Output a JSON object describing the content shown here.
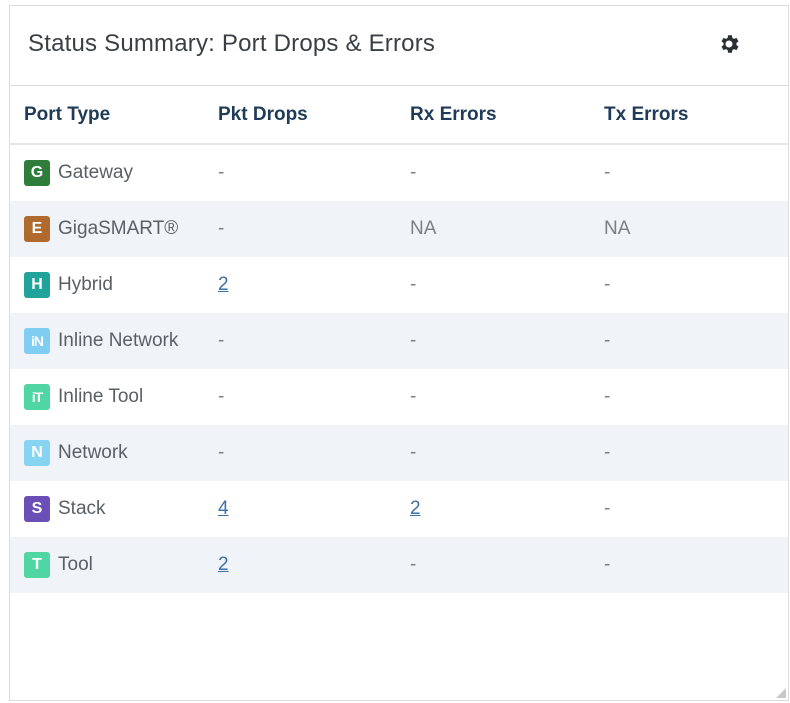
{
  "widget": {
    "title": "Status Summary: Port Drops & Errors",
    "settings_icon": "gear-icon"
  },
  "table": {
    "columns": [
      "Port Type",
      "Pkt Drops",
      "Rx Errors",
      "Tx Errors"
    ],
    "rows": [
      {
        "badge": "G",
        "badge_color": "#2e7d3a",
        "name": "Gateway",
        "pkt_drops": "-",
        "rx_errors": "-",
        "tx_errors": "-"
      },
      {
        "badge": "E",
        "badge_color": "#b06a2e",
        "name": "GigaSMART®",
        "pkt_drops": "-",
        "rx_errors": "NA",
        "tx_errors": "NA"
      },
      {
        "badge": "H",
        "badge_color": "#1fa39a",
        "name": "Hybrid",
        "pkt_drops": "2",
        "rx_errors": "-",
        "tx_errors": "-"
      },
      {
        "badge": "iN",
        "badge_color": "#7fcdf0",
        "name": "Inline Network",
        "pkt_drops": "-",
        "rx_errors": "-",
        "tx_errors": "-"
      },
      {
        "badge": "iT",
        "badge_color": "#4fd6a3",
        "name": "Inline Tool",
        "pkt_drops": "-",
        "rx_errors": "-",
        "tx_errors": "-"
      },
      {
        "badge": "N",
        "badge_color": "#86d3f2",
        "name": "Network",
        "pkt_drops": "-",
        "rx_errors": "-",
        "tx_errors": "-"
      },
      {
        "badge": "S",
        "badge_color": "#6a4fb6",
        "name": "Stack",
        "pkt_drops": "4",
        "rx_errors": "2",
        "tx_errors": "-"
      },
      {
        "badge": "T",
        "badge_color": "#4fd6a3",
        "name": "Tool",
        "pkt_drops": "2",
        "rx_errors": "-",
        "tx_errors": "-"
      }
    ]
  }
}
